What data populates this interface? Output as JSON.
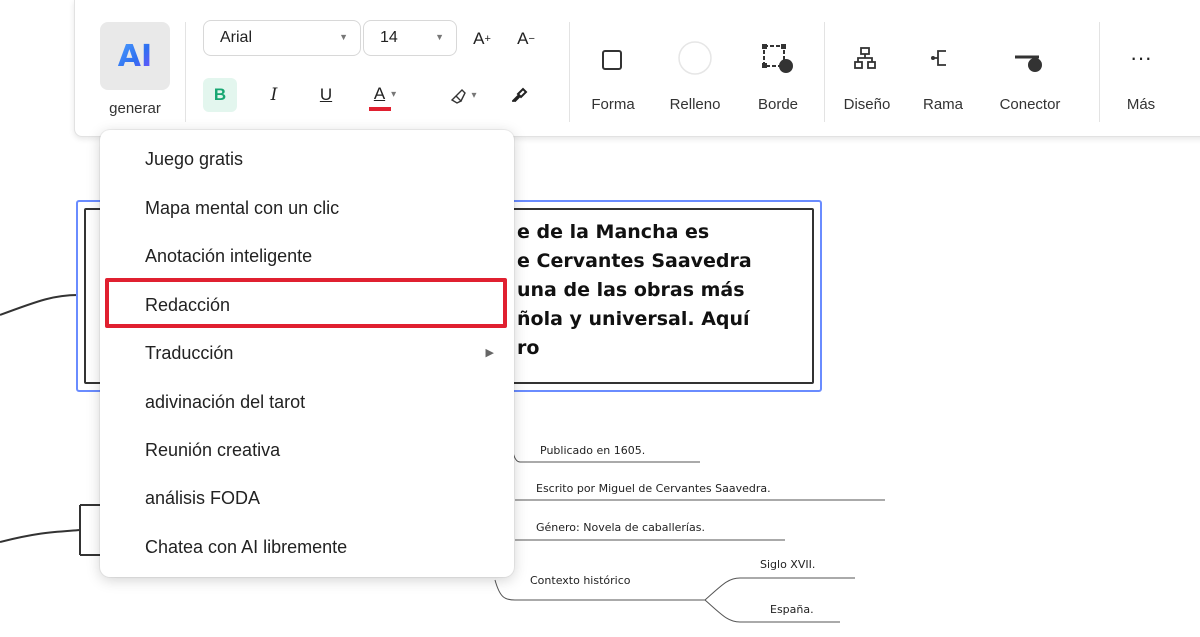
{
  "toolbar": {
    "ai_logo": "AI",
    "ai_label": "generar",
    "font_family": "Arial",
    "font_size": "14",
    "increase_font": "A",
    "increase_sup": "+",
    "decrease_font": "A",
    "decrease_sup": "−",
    "bold": "B",
    "italic": "I",
    "underline": "U",
    "font_color": "A",
    "tools": [
      {
        "label": "Forma"
      },
      {
        "label": "Relleno"
      },
      {
        "label": "Borde"
      },
      {
        "label": "Diseño"
      },
      {
        "label": "Rama"
      },
      {
        "label": "Conector"
      },
      {
        "label": "Más"
      }
    ],
    "more_dots": "···"
  },
  "canvas": {
    "main_topic_text": "e de la Mancha es\ne Cervantes Saavedra\nuna de las obras más\nñola y universal. Aquí\nro",
    "leaves": [
      "Publicado en 1605.",
      "Escrito por Miguel de Cervantes Saavedra.",
      "Género: Novela de caballerías.",
      "Contexto histórico",
      "Siglo XVII.",
      "España."
    ]
  },
  "menu": {
    "items": [
      {
        "label": "Juego gratis"
      },
      {
        "label": "Mapa mental con un clic"
      },
      {
        "label": "Anotación inteligente"
      },
      {
        "label": "Redacción"
      },
      {
        "label": "Traducción",
        "submenu": "▶"
      },
      {
        "label": "adivinación del tarot"
      },
      {
        "label": "Reunión creativa"
      },
      {
        "label": "análisis FODA"
      },
      {
        "label": "Chatea con AI libremente"
      }
    ],
    "highlighted": "Redacción"
  },
  "colors": {
    "bold_bg": "#e3f6ee",
    "bold_fg": "#18a772",
    "font_color_bar": "#e02030",
    "highlight": "#e02030",
    "selection": "#6a8cff"
  }
}
